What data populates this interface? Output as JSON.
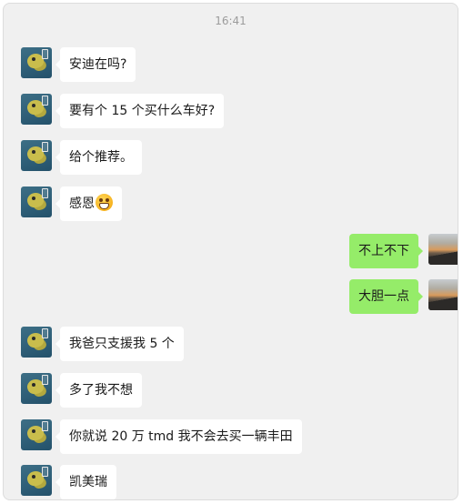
{
  "chat": {
    "timestamp": "16:41",
    "messages": [
      {
        "sender": "friend",
        "text": "安迪在吗?"
      },
      {
        "sender": "friend",
        "text": "要有个 15 个买什么车好?"
      },
      {
        "sender": "friend",
        "text": "给个推荐。"
      },
      {
        "sender": "friend",
        "text": "感恩",
        "emoji": "grinning-face-emoji"
      },
      {
        "sender": "self",
        "text": "不上不下"
      },
      {
        "sender": "self",
        "text": "大胆一点"
      },
      {
        "sender": "friend",
        "text": "我爸只支援我 5 个"
      },
      {
        "sender": "friend",
        "text": "多了我不想"
      },
      {
        "sender": "friend",
        "text": "你就说 20 万 tmd 我不会去买一辆丰田"
      },
      {
        "sender": "friend",
        "text": "凯美瑞"
      }
    ]
  },
  "colors": {
    "background": "#f0f0f0",
    "self_bubble": "#95ec69",
    "friend_bubble": "#ffffff"
  },
  "icons": {
    "friend_avatar": "frog-avatar",
    "self_avatar": "sunset-avatar"
  }
}
